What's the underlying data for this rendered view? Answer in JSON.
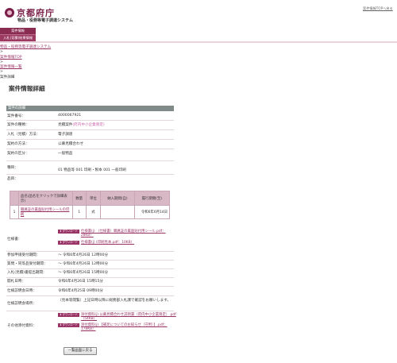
{
  "header": {
    "logo_text": "京都府庁",
    "system_name": "物品・役務等電子調達システム",
    "help_link": "案件情報TOPへ戻る"
  },
  "nav": {
    "items": [
      "案件情報",
      "入札(見積)結果情報"
    ]
  },
  "breadcrumb": {
    "items": [
      "物品・役務等電子調達システム",
      "案件情報TOP",
      "案件情報一覧"
    ],
    "separator": ">",
    "current": "案件詳細"
  },
  "page_title": "案件情報詳細",
  "section_title": "案件の詳細",
  "details": {
    "case_number_label": "案件番号：",
    "case_number": "4000067921",
    "case_type_label": "案件の種類：",
    "case_type": "見積案件",
    "case_type_note": "(府内中小企業限定)",
    "bid_method_label": "入札（見積）方法：",
    "bid_method": "電子調達",
    "contract_method_label": "契約の方法：",
    "contract_method": "公募見積合わせ",
    "category_label": "契約の区分：",
    "category": "一般物品",
    "item_label": "種目：",
    "item": "01 物品等 001 印刷・製本 001 一般印刷",
    "product_label": "品目："
  },
  "items_table": {
    "headers": [
      "品名(品名をクリックで詳細表示)",
      "数量",
      "単位",
      "納入期間(自)",
      "履行期間(至)"
    ],
    "rows": [
      {
        "no": "1",
        "name": "職員証の裏面貼付用シールの印刷",
        "qty": "1",
        "unit": "式",
        "from": "",
        "to": "令和6年6月14日"
      }
    ]
  },
  "spec": {
    "label": "仕様書：",
    "download_badge": "⬇ ダウンロード",
    "files": [
      "仕様書(j) （仕様書）職員証の裏面貼付用シール.pdf：28KB）",
      "仕様書(j) (印刷見本.pdf：10KB）"
    ]
  },
  "schedule": {
    "app_label": "参加申請受付期間：",
    "app_value": "〜 令和6年4月26日 12時00分",
    "question_label": "質問・同等品受付期間：",
    "question_value": "〜 令和6年4月26日 12時00分",
    "bid_label": "入札(見積)書提出期間：",
    "bid_value": "〜 令和6年4月26日 15時00分",
    "open_label": "開札日時：",
    "open_value": "令和6年4月26日 15時15分",
    "spec_date_label": "仕様説明会日時：",
    "spec_date_value": "令和6年4月25日 09時00分",
    "spec_place_label": "仕様説明会場所：",
    "spec_place_value": "（見本等閲覧）上記日時以降に総務部入札課で確認をお願いします。"
  },
  "other": {
    "label": "その他添付資料：",
    "files": [
      "添付資料(j) 公募見積合わせ説明書（府内中小企業限定）.pdf （54KB）",
      "添付資料(j) 【補足についてのお知らせ（守用）】.pdf：178KB）"
    ]
  },
  "back_button": "一覧画面に戻る"
}
